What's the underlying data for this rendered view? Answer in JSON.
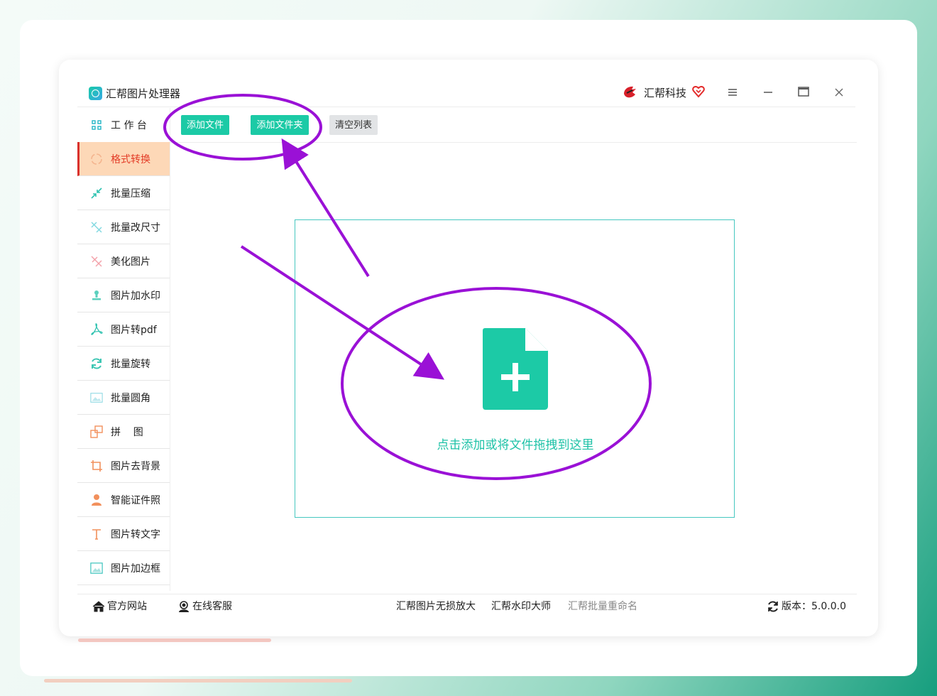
{
  "app": {
    "title": "汇帮图片处理器",
    "brand": "汇帮科技",
    "window_controls": [
      "menu-icon",
      "minimize-icon",
      "maximize-icon",
      "close-icon"
    ]
  },
  "sidebar": {
    "items": [
      {
        "label": "工 作 台",
        "icon": "grid-icon",
        "active": false
      },
      {
        "label": "格式转换",
        "icon": "convert-icon",
        "active": true
      },
      {
        "label": "批量压缩",
        "icon": "compress-icon",
        "active": false
      },
      {
        "label": "批量改尺寸",
        "icon": "resize-icon",
        "active": false
      },
      {
        "label": "美化图片",
        "icon": "beautify-icon",
        "active": false
      },
      {
        "label": "图片加水印",
        "icon": "watermark-icon",
        "active": false
      },
      {
        "label": "图片转pdf",
        "icon": "pdf-icon",
        "active": false
      },
      {
        "label": "批量旋转",
        "icon": "rotate-icon",
        "active": false
      },
      {
        "label": "批量圆角",
        "icon": "round-corner-icon",
        "active": false
      },
      {
        "label": "拼    图",
        "icon": "collage-icon",
        "active": false
      },
      {
        "label": "图片去背景",
        "icon": "crop-icon",
        "active": false
      },
      {
        "label": "智能证件照",
        "icon": "person-icon",
        "active": false
      },
      {
        "label": "图片转文字",
        "icon": "text-icon",
        "active": false
      },
      {
        "label": "图片加边框",
        "icon": "frame-icon",
        "active": false
      }
    ]
  },
  "toolbar": {
    "add_file": "添加文件",
    "add_folder": "添加文件夹",
    "clear_list": "清空列表"
  },
  "dropzone": {
    "text": "点击添加或将文件拖拽到这里"
  },
  "footer": {
    "official_site": "官方网站",
    "online_service": "在线客服",
    "links": [
      "汇帮图片无损放大",
      "汇帮水印大师",
      "汇帮批量重命名"
    ],
    "version": "版本：5.0.0.0"
  },
  "colors": {
    "accent": "#1ccaa6",
    "active_bg": "#fdd8b7",
    "active_text": "#e33b26",
    "annotation": "#9a11d6"
  }
}
